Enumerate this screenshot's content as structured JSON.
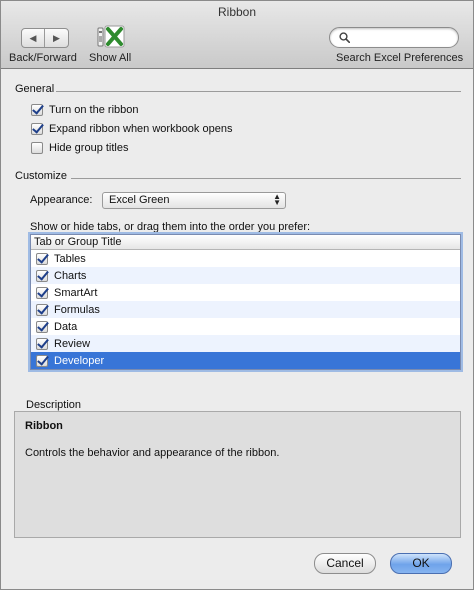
{
  "window": {
    "title": "Ribbon"
  },
  "toolbar": {
    "nav_label": "Back/Forward",
    "back_glyph": "◀",
    "forward_glyph": "▶",
    "show_all_label": "Show All",
    "search_placeholder": "",
    "search_label": "Search Excel Preferences"
  },
  "general": {
    "title": "General",
    "options": [
      {
        "label": "Turn on the ribbon",
        "checked": true
      },
      {
        "label": "Expand ribbon when workbook opens",
        "checked": true
      },
      {
        "label": "Hide group titles",
        "checked": false
      }
    ]
  },
  "customize": {
    "title": "Customize",
    "appearance_label": "Appearance:",
    "appearance_value": "Excel Green",
    "list_caption": "Show or hide tabs, or drag them into the order you prefer:",
    "column_header": "Tab or Group Title",
    "rows": [
      {
        "label": "Tables",
        "checked": true
      },
      {
        "label": "Charts",
        "checked": true
      },
      {
        "label": "SmartArt",
        "checked": true
      },
      {
        "label": "Formulas",
        "checked": true
      },
      {
        "label": "Data",
        "checked": true
      },
      {
        "label": "Review",
        "checked": true
      },
      {
        "label": "Developer",
        "checked": true,
        "selected": true
      }
    ]
  },
  "description": {
    "title": "Description",
    "heading": "Ribbon",
    "text": "Controls the behavior and appearance of the ribbon."
  },
  "buttons": {
    "cancel": "Cancel",
    "ok": "OK"
  },
  "colors": {
    "selection": "#3875d7",
    "alt_row": "#edf3fe",
    "excel_green": "#2e8b2e"
  }
}
